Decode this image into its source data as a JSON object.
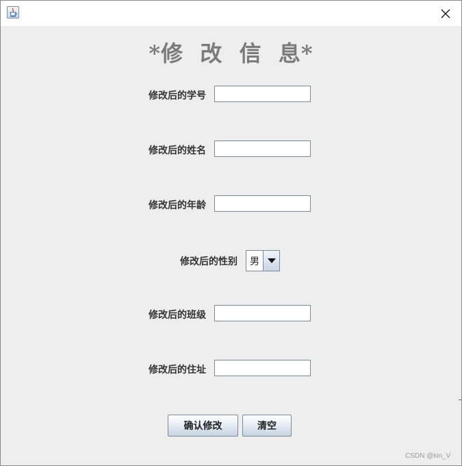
{
  "window": {
    "close_symbol": "✕"
  },
  "icons": {
    "app": "java-cup-icon",
    "close": "close-icon",
    "dropdown": "triangle-down-icon"
  },
  "form": {
    "heading": "*修  改  信  息*",
    "student_id": {
      "label": "修改后的学号",
      "value": ""
    },
    "name": {
      "label": "修改后的姓名",
      "value": ""
    },
    "age": {
      "label": "修改后的年龄",
      "value": ""
    },
    "gender": {
      "label": "修改后的性别",
      "selected": "男"
    },
    "class": {
      "label": "修改后的班级",
      "value": ""
    },
    "address": {
      "label": "修改后的住址",
      "value": ""
    }
  },
  "buttons": {
    "confirm": "确认修改",
    "clear": "清空"
  },
  "watermark": "CSDN @kin_V",
  "colors": {
    "background": "#eeeeee",
    "heading": "#7b7b7b",
    "titlebar": "#ffffff"
  }
}
